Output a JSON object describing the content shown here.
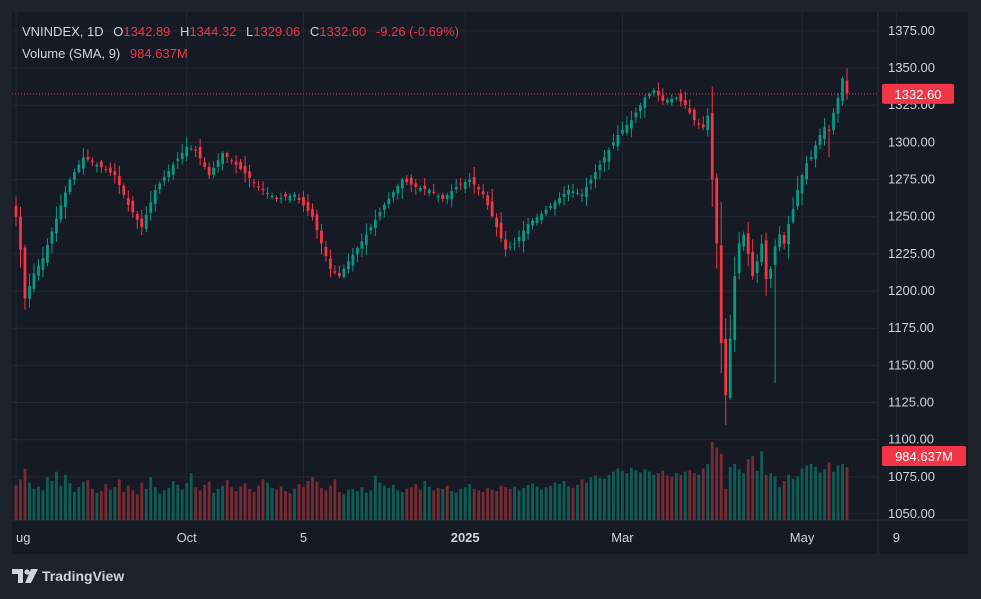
{
  "legend": {
    "symbol": "VNINDEX",
    "interval": "1D",
    "open_label": "O",
    "open": "1342.89",
    "high_label": "H",
    "high": "1344.32",
    "low_label": "L",
    "low": "1329.06",
    "close_label": "C",
    "close": "1332.60",
    "change": "-9.26 (-0.69%)",
    "volume_label": "Volume (SMA, 9)",
    "volume_value": "984.637M"
  },
  "price_tag": "1332.60",
  "volume_tag": "984.637M",
  "branding": "TradingView",
  "colors": {
    "up": "#089981",
    "down": "#f23645",
    "vol_up": "#0e5e55",
    "vol_down": "#7a2a33",
    "background": "#161a25",
    "grid": "#232836",
    "text": "#d1d4dc"
  },
  "chart_data": {
    "type": "candlestick",
    "symbol": "VNINDEX",
    "interval": "1D",
    "y_ticks": [
      1050,
      1075,
      1100,
      1125,
      1150,
      1175,
      1200,
      1225,
      1250,
      1275,
      1300,
      1325,
      1350,
      1375
    ],
    "y_tick_labels": [
      "1050.00",
      "1075.00",
      "1100.00",
      "1125.00",
      "1150.00",
      "1175.00",
      "1200.00",
      "1225.00",
      "1250.00",
      "1275.00",
      "1300.00",
      "1325.00",
      "1350.00",
      "1375.00"
    ],
    "ylim": [
      1046,
      1385
    ],
    "x_labels": [
      {
        "label": "ug",
        "index": 0
      },
      {
        "label": "Oct",
        "index": 38
      },
      {
        "label": "5",
        "index": 64
      },
      {
        "label": "2025",
        "index": 100
      },
      {
        "label": "Mar",
        "index": 135
      },
      {
        "label": "May",
        "index": 175
      },
      {
        "label": "9",
        "index": 196
      }
    ],
    "last_price": 1332.6,
    "keyframes": [
      [
        0,
        1250
      ],
      [
        1,
        1228
      ],
      [
        2,
        1195
      ],
      [
        4,
        1212
      ],
      [
        6,
        1222
      ],
      [
        8,
        1240
      ],
      [
        12,
        1275
      ],
      [
        15,
        1290
      ],
      [
        18,
        1285
      ],
      [
        22,
        1278
      ],
      [
        25,
        1258
      ],
      [
        28,
        1243
      ],
      [
        31,
        1268
      ],
      [
        35,
        1285
      ],
      [
        38,
        1297
      ],
      [
        40,
        1295
      ],
      [
        43,
        1278
      ],
      [
        46,
        1293
      ],
      [
        50,
        1282
      ],
      [
        54,
        1270
      ],
      [
        58,
        1262
      ],
      [
        62,
        1265
      ],
      [
        66,
        1250
      ],
      [
        68,
        1232
      ],
      [
        70,
        1215
      ],
      [
        72,
        1210
      ],
      [
        74,
        1220
      ],
      [
        78,
        1238
      ],
      [
        82,
        1258
      ],
      [
        86,
        1275
      ],
      [
        89,
        1270
      ],
      [
        92,
        1268
      ],
      [
        95,
        1262
      ],
      [
        98,
        1270
      ],
      [
        101,
        1275
      ],
      [
        104,
        1265
      ],
      [
        107,
        1243
      ],
      [
        109,
        1228
      ],
      [
        111,
        1232
      ],
      [
        114,
        1245
      ],
      [
        117,
        1252
      ],
      [
        120,
        1260
      ],
      [
        123,
        1268
      ],
      [
        126,
        1265
      ],
      [
        130,
        1285
      ],
      [
        134,
        1305
      ],
      [
        137,
        1315
      ],
      [
        140,
        1330
      ],
      [
        142,
        1335
      ],
      [
        144,
        1328
      ],
      [
        147,
        1330
      ],
      [
        149,
        1325
      ],
      [
        151,
        1315
      ],
      [
        153,
        1310
      ],
      [
        154,
        1318
      ],
      [
        155,
        1275
      ],
      [
        156,
        1232
      ],
      [
        157,
        1165
      ],
      [
        158,
        1130
      ],
      [
        159,
        1168
      ],
      [
        160,
        1210
      ],
      [
        161,
        1232
      ],
      [
        162,
        1238
      ],
      [
        163,
        1225
      ],
      [
        164,
        1210
      ],
      [
        165,
        1220
      ],
      [
        166,
        1232
      ],
      [
        167,
        1208
      ],
      [
        168,
        1215
      ],
      [
        169,
        1230
      ],
      [
        170,
        1238
      ],
      [
        171,
        1232
      ],
      [
        172,
        1245
      ],
      [
        173,
        1255
      ],
      [
        174,
        1268
      ],
      [
        175,
        1278
      ],
      [
        176,
        1286
      ],
      [
        177,
        1290
      ],
      [
        178,
        1298
      ],
      [
        179,
        1305
      ],
      [
        180,
        1310
      ],
      [
        181,
        1308
      ],
      [
        182,
        1320
      ],
      [
        183,
        1330
      ],
      [
        184,
        1343
      ],
      [
        185,
        1333
      ]
    ],
    "volume_note": "volume bars scaled 0-1 of pane height",
    "volume_levels": [
      0.45,
      0.52,
      0.66,
      0.48,
      0.4,
      0.43,
      0.38,
      0.55,
      0.5,
      0.62,
      0.44,
      0.58,
      0.47,
      0.36,
      0.42,
      0.49,
      0.51,
      0.4,
      0.35,
      0.37,
      0.46,
      0.39,
      0.42,
      0.52,
      0.36,
      0.44,
      0.38,
      0.33,
      0.48,
      0.4,
      0.55,
      0.42,
      0.34,
      0.38,
      0.41,
      0.5,
      0.45,
      0.39,
      0.47,
      0.6,
      0.42,
      0.38,
      0.45,
      0.49,
      0.35,
      0.4,
      0.44,
      0.51,
      0.42,
      0.37,
      0.43,
      0.47,
      0.4,
      0.36,
      0.44,
      0.52,
      0.48,
      0.41,
      0.39,
      0.43,
      0.37,
      0.34,
      0.4,
      0.46,
      0.42,
      0.5,
      0.55,
      0.49,
      0.41,
      0.38,
      0.44,
      0.52,
      0.36,
      0.33,
      0.39,
      0.4,
      0.37,
      0.42,
      0.35,
      0.38,
      0.57,
      0.48,
      0.44,
      0.41,
      0.45,
      0.38,
      0.36,
      0.4,
      0.42,
      0.46,
      0.39,
      0.5,
      0.43,
      0.38,
      0.41,
      0.4,
      0.44,
      0.37,
      0.35,
      0.4,
      0.42,
      0.46,
      0.4,
      0.38,
      0.36,
      0.41,
      0.39,
      0.37,
      0.44,
      0.42,
      0.4,
      0.43,
      0.38,
      0.41,
      0.45,
      0.47,
      0.43,
      0.39,
      0.42,
      0.44,
      0.48,
      0.46,
      0.5,
      0.43,
      0.41,
      0.45,
      0.52,
      0.48,
      0.55,
      0.57,
      0.54,
      0.53,
      0.58,
      0.62,
      0.66,
      0.63,
      0.6,
      0.67,
      0.64,
      0.61,
      0.65,
      0.62,
      0.58,
      0.6,
      0.63,
      0.57,
      0.55,
      0.6,
      0.58,
      0.62,
      0.64,
      0.6,
      0.58,
      0.66,
      0.72,
      1.0,
      0.93,
      0.85,
      0.4,
      0.68,
      0.72,
      0.65,
      0.6,
      0.78,
      0.82,
      0.63,
      0.88,
      0.58,
      0.6,
      0.56,
      0.42,
      0.5,
      0.58,
      0.53,
      0.56,
      0.66,
      0.7,
      0.72,
      0.68,
      0.61,
      0.65,
      0.74,
      0.62,
      0.7,
      0.72,
      0.68,
      0.67
    ]
  }
}
